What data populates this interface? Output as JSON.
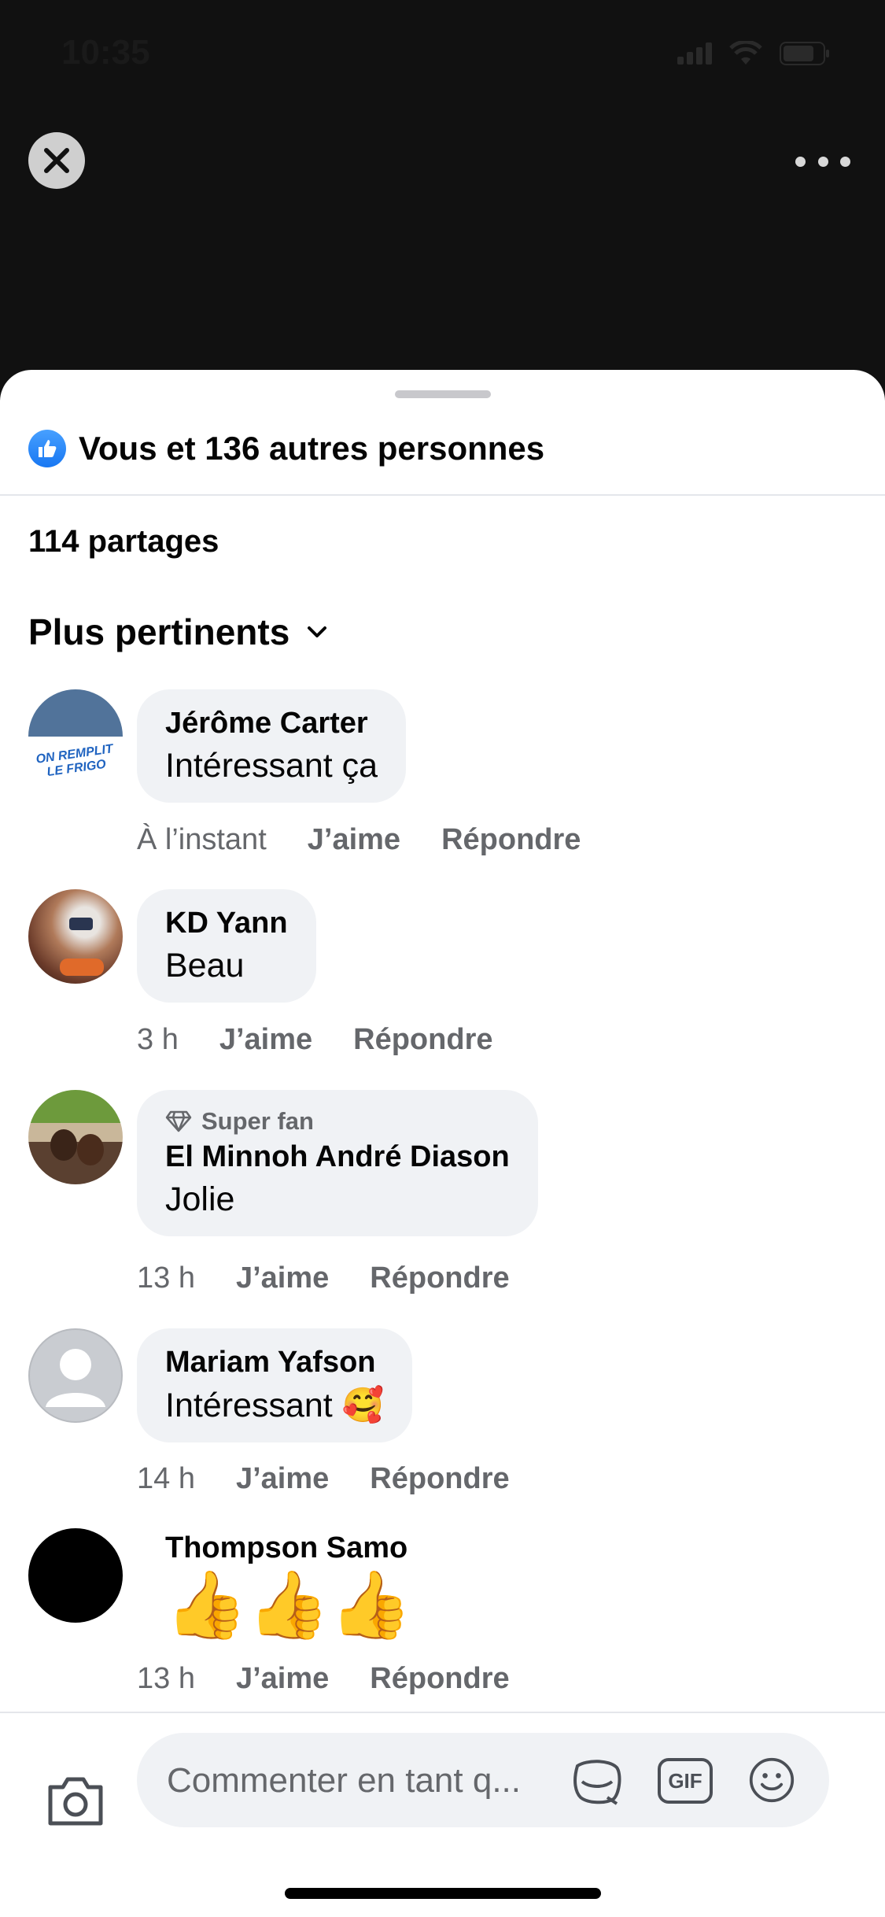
{
  "status": {
    "time": "10:35"
  },
  "reactions": {
    "summary": "Vous et 136 autres personnes"
  },
  "shares": {
    "label": "114 partages"
  },
  "sort": {
    "label": "Plus pertinents"
  },
  "comments": [
    {
      "author": "Jérôme Carter",
      "text": "Intéressant ça",
      "time": "À l’instant",
      "like": "J’aime",
      "reply": "Répondre",
      "avatar_text": "ON REMPLIT LE FRIGO"
    },
    {
      "author": "KD Yann",
      "text": "Beau",
      "time": "3 h",
      "like": "J’aime",
      "reply": "Répondre"
    },
    {
      "author": "El Minnoh André Diason",
      "badge": "Super fan",
      "text": "Jolie",
      "time": "13 h",
      "like": "J’aime",
      "reply": "Répondre"
    },
    {
      "author": "Mariam Yafson",
      "text": "Intéressant 🥰",
      "time": "14 h",
      "like": "J’aime",
      "reply": "Répondre"
    },
    {
      "author": "Thompson Samo",
      "text": "👍👍👍",
      "time": "13 h",
      "like": "J’aime",
      "reply": "Répondre"
    }
  ],
  "composer": {
    "placeholder": "Commenter en tant q...",
    "gif_label": "GIF"
  },
  "colors": {
    "accent": "#1877f2",
    "bubble": "#f0f2f5",
    "secondary_text": "#65676b"
  }
}
